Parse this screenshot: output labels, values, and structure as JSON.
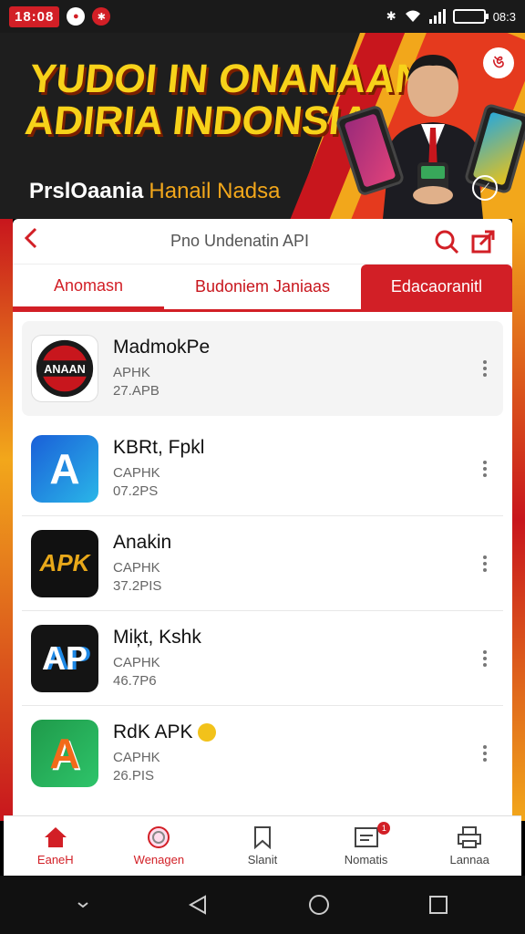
{
  "status": {
    "time": "18:08",
    "right_text": "08:3"
  },
  "banner": {
    "title_line1": "YUDOI IN ONANAAN",
    "title_line2": "ADIRIA INDONSIAI",
    "sub_white": "PrslOaania",
    "sub_orange": "Hanail Nadsa"
  },
  "appbar": {
    "title": "Pno Undenatin API"
  },
  "tabs": [
    {
      "label": "Anomasn"
    },
    {
      "label": "Budoniem Janiaas"
    },
    {
      "label": "Edacaoranitl"
    }
  ],
  "apps": [
    {
      "name": "MadmokPe",
      "type": "APHK",
      "size": "27.APB",
      "icon": "anaan-red-icon",
      "icon_text": "ANAAN"
    },
    {
      "name": "KBRt, Fpkl",
      "type": "CAPHK",
      "size": "07.2PS",
      "icon": "blue-a-icon",
      "icon_text": "A"
    },
    {
      "name": "Anakin",
      "type": "CAPHK",
      "size": "37.2PIS",
      "icon": "apk-gold-icon",
      "icon_text": "APK"
    },
    {
      "name": "Miķt, Kshk",
      "type": "CAPHK",
      "size": "46.7P6",
      "icon": "ap-dark-icon",
      "icon_text": "AP"
    },
    {
      "name": "RdK APK",
      "type": "CAPHK",
      "size": "26.PIS",
      "icon": "green-a-icon",
      "icon_text": "A"
    }
  ],
  "bottom_nav": [
    {
      "label": "EaneH",
      "icon": "home-icon"
    },
    {
      "label": "Wenagen",
      "icon": "globe-icon"
    },
    {
      "label": "Slanit",
      "icon": "bookmark-icon"
    },
    {
      "label": "Nomatis",
      "icon": "inbox-icon",
      "badge": "1"
    },
    {
      "label": "Lannaa",
      "icon": "printer-icon"
    }
  ],
  "colors": {
    "accent": "#d21f26",
    "banner_yellow": "#f7d21a",
    "banner_orange": "#f2a71b"
  }
}
